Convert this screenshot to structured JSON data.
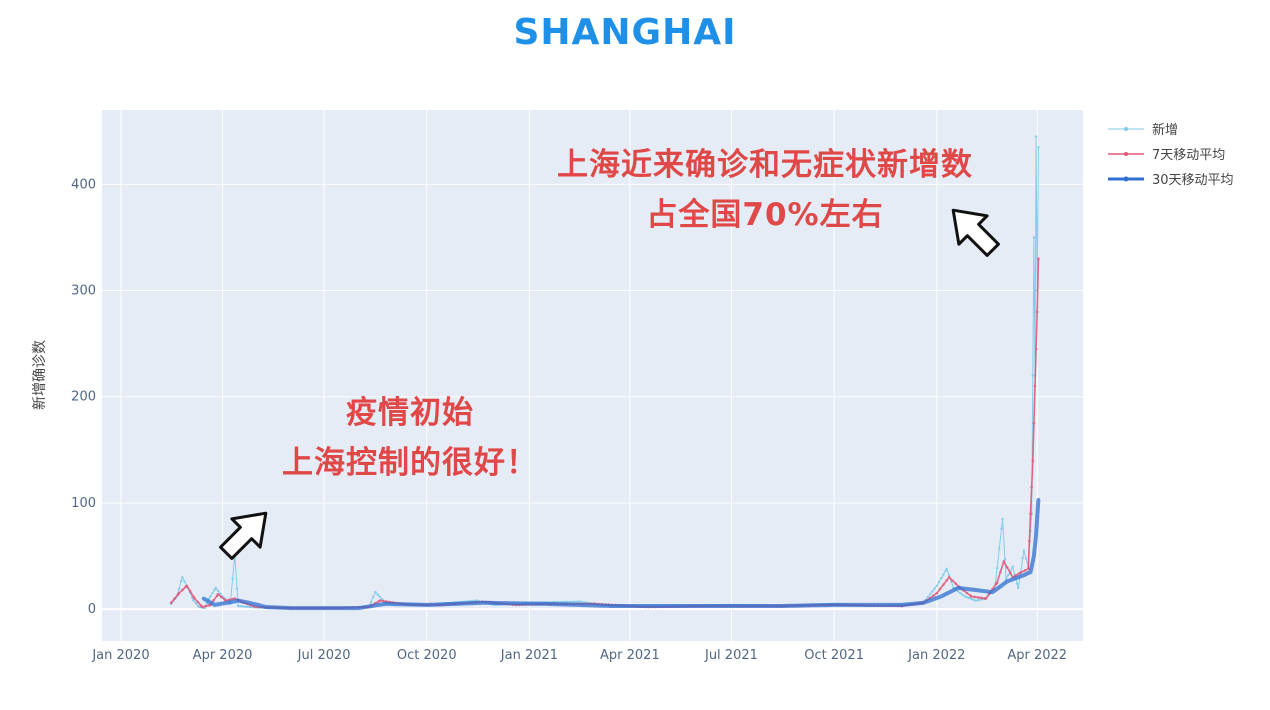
{
  "title": "SHANGHAI",
  "annotations": {
    "top_right_line1": "上海近来确诊和无症状新增数",
    "top_right_line2": "占全国70%左右",
    "middle_line1": "疫情初始",
    "middle_line2": "上海控制的很好！"
  },
  "chart_data": {
    "type": "line",
    "title": "SHANGHAI",
    "xlabel": "",
    "ylabel": "新增确诊数",
    "x_start": "2020-02-15",
    "x_end": "2022-04-02",
    "xlim": [
      "2019-12-15",
      "2022-05-12"
    ],
    "ylim": [
      -30,
      470
    ],
    "x_ticks": [
      "Jan 2020",
      "Apr 2020",
      "Jul 2020",
      "Oct 2020",
      "Jan 2021",
      "Apr 2021",
      "Jul 2021",
      "Oct 2021",
      "Jan 2022",
      "Apr 2022"
    ],
    "y_ticks": [
      0,
      100,
      200,
      300,
      400
    ],
    "grid": true,
    "legend_position": "top-right",
    "series": [
      {
        "name": "新增",
        "color": "#7ecbea",
        "keypoints": [
          [
            "2020-02-15",
            5
          ],
          [
            "2020-02-20",
            12
          ],
          [
            "2020-02-25",
            30
          ],
          [
            "2020-03-01",
            20
          ],
          [
            "2020-03-06",
            8
          ],
          [
            "2020-03-11",
            2
          ],
          [
            "2020-03-16",
            1
          ],
          [
            "2020-03-21",
            12
          ],
          [
            "2020-03-26",
            20
          ],
          [
            "2020-04-01",
            12
          ],
          [
            "2020-04-08",
            5
          ],
          [
            "2020-04-12",
            52
          ],
          [
            "2020-04-15",
            3
          ],
          [
            "2020-04-25",
            2
          ],
          [
            "2020-05-15",
            1
          ],
          [
            "2020-07-01",
            1
          ],
          [
            "2020-08-10",
            2
          ],
          [
            "2020-08-16",
            16
          ],
          [
            "2020-08-25",
            6
          ],
          [
            "2020-10-01",
            4
          ],
          [
            "2020-11-15",
            8
          ],
          [
            "2020-12-01",
            4
          ],
          [
            "2021-01-01",
            6
          ],
          [
            "2021-02-15",
            7
          ],
          [
            "2021-03-15",
            3
          ],
          [
            "2021-05-01",
            3
          ],
          [
            "2021-07-01",
            4
          ],
          [
            "2021-08-15",
            3
          ],
          [
            "2021-10-01",
            5
          ],
          [
            "2021-11-01",
            3
          ],
          [
            "2021-12-01",
            4
          ],
          [
            "2021-12-20",
            6
          ],
          [
            "2022-01-01",
            22
          ],
          [
            "2022-01-10",
            38
          ],
          [
            "2022-01-16",
            20
          ],
          [
            "2022-01-26",
            12
          ],
          [
            "2022-02-05",
            8
          ],
          [
            "2022-02-14",
            10
          ],
          [
            "2022-02-22",
            20
          ],
          [
            "2022-03-01",
            85
          ],
          [
            "2022-03-04",
            28
          ],
          [
            "2022-03-10",
            40
          ],
          [
            "2022-03-15",
            20
          ],
          [
            "2022-03-20",
            55
          ],
          [
            "2022-03-24",
            40
          ],
          [
            "2022-03-27",
            90
          ],
          [
            "2022-03-29",
            350
          ],
          [
            "2022-03-30",
            220
          ],
          [
            "2022-03-31",
            445
          ],
          [
            "2022-04-01",
            300
          ],
          [
            "2022-04-02",
            435
          ]
        ]
      },
      {
        "name": "7天移动平均",
        "color": "#e05878",
        "keypoints": [
          [
            "2020-02-15",
            6
          ],
          [
            "2020-02-22",
            15
          ],
          [
            "2020-02-29",
            22
          ],
          [
            "2020-03-07",
            10
          ],
          [
            "2020-03-14",
            2
          ],
          [
            "2020-03-21",
            4
          ],
          [
            "2020-03-28",
            14
          ],
          [
            "2020-04-04",
            8
          ],
          [
            "2020-04-12",
            10
          ],
          [
            "2020-04-20",
            6
          ],
          [
            "2020-05-01",
            2
          ],
          [
            "2020-06-01",
            1
          ],
          [
            "2020-07-15",
            1
          ],
          [
            "2020-08-10",
            2
          ],
          [
            "2020-08-20",
            8
          ],
          [
            "2020-09-15",
            4
          ],
          [
            "2020-10-15",
            4
          ],
          [
            "2020-11-20",
            7
          ],
          [
            "2020-12-20",
            4
          ],
          [
            "2021-01-20",
            5
          ],
          [
            "2021-03-01",
            5
          ],
          [
            "2021-04-15",
            2
          ],
          [
            "2021-06-15",
            3
          ],
          [
            "2021-08-15",
            3
          ],
          [
            "2021-10-01",
            4
          ],
          [
            "2021-12-01",
            3
          ],
          [
            "2021-12-20",
            6
          ],
          [
            "2022-01-01",
            15
          ],
          [
            "2022-01-12",
            30
          ],
          [
            "2022-01-22",
            20
          ],
          [
            "2022-02-01",
            12
          ],
          [
            "2022-02-14",
            10
          ],
          [
            "2022-02-24",
            25
          ],
          [
            "2022-03-02",
            45
          ],
          [
            "2022-03-10",
            30
          ],
          [
            "2022-03-18",
            35
          ],
          [
            "2022-03-24",
            38
          ],
          [
            "2022-03-26",
            90
          ],
          [
            "2022-03-28",
            140
          ],
          [
            "2022-03-30",
            210
          ],
          [
            "2022-04-01",
            280
          ],
          [
            "2022-04-02",
            330
          ]
        ]
      },
      {
        "name": "30天移动平均",
        "color": "#2f6fd0",
        "keypoints": [
          [
            "2020-03-15",
            10
          ],
          [
            "2020-03-25",
            4
          ],
          [
            "2020-04-05",
            6
          ],
          [
            "2020-04-15",
            8
          ],
          [
            "2020-04-25",
            6
          ],
          [
            "2020-05-10",
            2
          ],
          [
            "2020-06-01",
            1
          ],
          [
            "2020-08-01",
            1
          ],
          [
            "2020-08-25",
            5
          ],
          [
            "2020-10-01",
            4
          ],
          [
            "2020-11-20",
            6
          ],
          [
            "2021-01-15",
            5
          ],
          [
            "2021-03-15",
            3
          ],
          [
            "2021-06-01",
            3
          ],
          [
            "2021-08-15",
            3
          ],
          [
            "2021-10-01",
            4
          ],
          [
            "2021-12-01",
            4
          ],
          [
            "2021-12-20",
            6
          ],
          [
            "2022-01-05",
            12
          ],
          [
            "2022-01-20",
            20
          ],
          [
            "2022-02-05",
            18
          ],
          [
            "2022-02-20",
            16
          ],
          [
            "2022-03-05",
            26
          ],
          [
            "2022-03-20",
            32
          ],
          [
            "2022-03-26",
            35
          ],
          [
            "2022-03-29",
            50
          ],
          [
            "2022-03-31",
            70
          ],
          [
            "2022-04-02",
            103
          ]
        ]
      }
    ]
  }
}
